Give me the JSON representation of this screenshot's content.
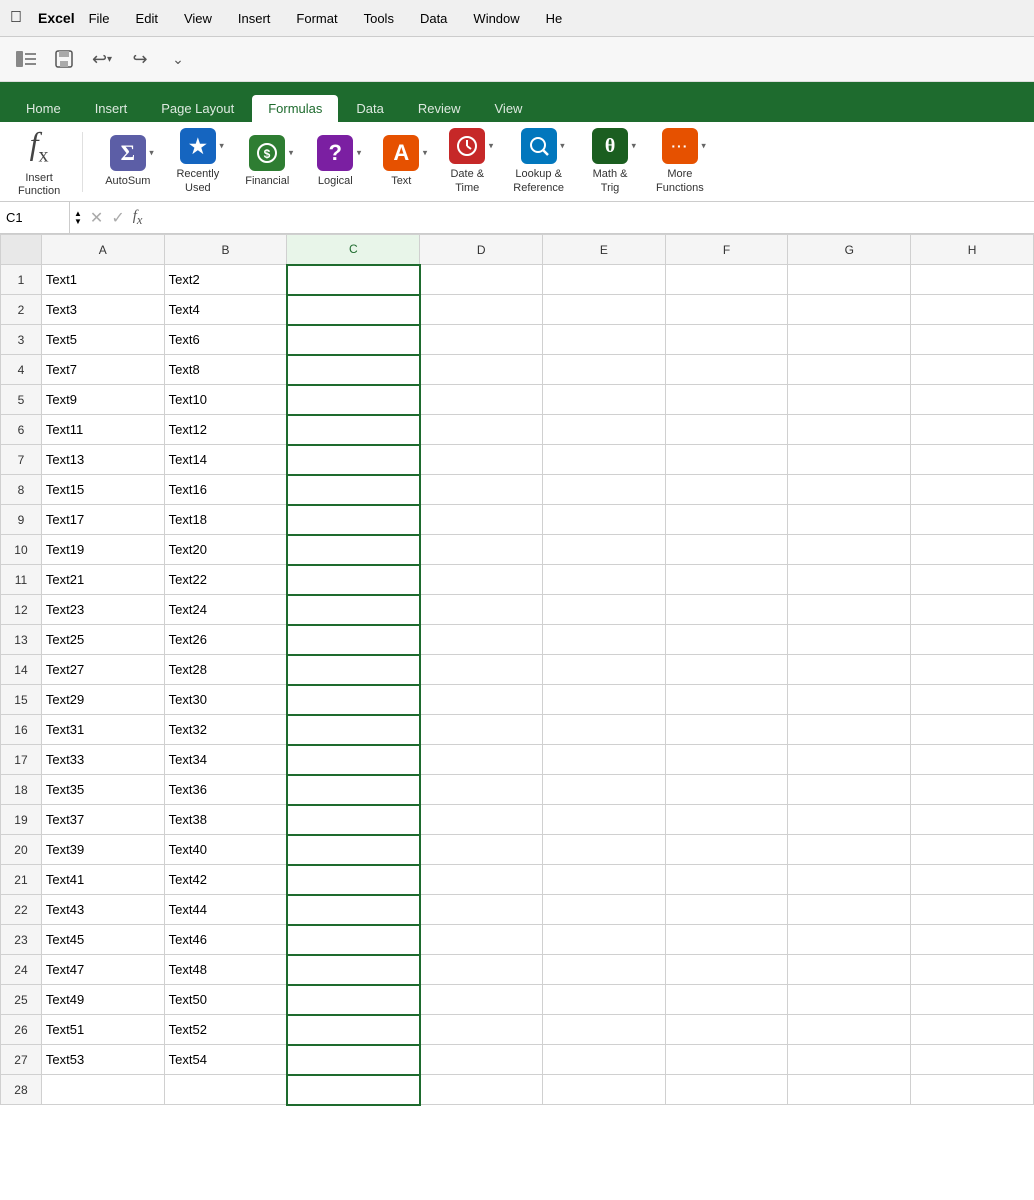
{
  "menubar": {
    "app": "Excel",
    "items": [
      "File",
      "Edit",
      "View",
      "Insert",
      "Format",
      "Tools",
      "Data",
      "Window",
      "He"
    ]
  },
  "toolbar": {
    "buttons": [
      "sidebar-icon",
      "save-icon",
      "undo-icon",
      "redo-icon",
      "more-icon"
    ]
  },
  "ribbonTabs": {
    "tabs": [
      "Home",
      "Insert",
      "Page Layout",
      "Formulas",
      "Data",
      "Review",
      "View"
    ],
    "activeTab": "Formulas"
  },
  "ribbonGroups": [
    {
      "id": "insert-function",
      "icon": "fx",
      "label": "Insert\nFunction",
      "color": "#888",
      "type": "fx"
    },
    {
      "id": "autosum",
      "icon": "Σ",
      "label": "AutoSum",
      "color": "#5b5ea6",
      "hasArrow": true
    },
    {
      "id": "recently-used",
      "icon": "★",
      "label": "Recently\nUsed",
      "color": "#1565c0",
      "hasArrow": true
    },
    {
      "id": "financial",
      "icon": "$",
      "label": "Financial",
      "color": "#2e7d32",
      "hasArrow": true
    },
    {
      "id": "logical",
      "icon": "?",
      "label": "Logical",
      "color": "#7b1fa2",
      "hasArrow": true
    },
    {
      "id": "text",
      "icon": "A",
      "label": "Text",
      "color": "#e65100",
      "hasArrow": true
    },
    {
      "id": "date-time",
      "icon": "⏰",
      "label": "Date &\nTime",
      "color": "#c62828",
      "hasArrow": true
    },
    {
      "id": "lookup-reference",
      "icon": "🔍",
      "label": "Lookup &\nReference",
      "color": "#0277bd",
      "hasArrow": true
    },
    {
      "id": "math-trig",
      "icon": "θ",
      "label": "Math &\nTrig",
      "color": "#1b5e20",
      "hasArrow": true
    },
    {
      "id": "more-functions",
      "icon": "···",
      "label": "More\nFunctions",
      "color": "#e65100",
      "hasArrow": true
    }
  ],
  "formulaBar": {
    "cellRef": "C1",
    "formula": ""
  },
  "columns": [
    "",
    "A",
    "B",
    "C",
    "D",
    "E",
    "F",
    "G",
    "H"
  ],
  "rows": [
    {
      "row": 1,
      "A": "Text1",
      "B": "Text2",
      "C": "",
      "D": "",
      "E": "",
      "F": "",
      "G": "",
      "H": ""
    },
    {
      "row": 2,
      "A": "Text3",
      "B": "Text4",
      "C": "",
      "D": "",
      "E": "",
      "F": "",
      "G": "",
      "H": ""
    },
    {
      "row": 3,
      "A": "Text5",
      "B": "Text6",
      "C": "",
      "D": "",
      "E": "",
      "F": "",
      "G": "",
      "H": ""
    },
    {
      "row": 4,
      "A": "Text7",
      "B": "Text8",
      "C": "",
      "D": "",
      "E": "",
      "F": "",
      "G": "",
      "H": ""
    },
    {
      "row": 5,
      "A": "Text9",
      "B": "Text10",
      "C": "",
      "D": "",
      "E": "",
      "F": "",
      "G": "",
      "H": ""
    },
    {
      "row": 6,
      "A": "Text11",
      "B": "Text12",
      "C": "",
      "D": "",
      "E": "",
      "F": "",
      "G": "",
      "H": ""
    },
    {
      "row": 7,
      "A": "Text13",
      "B": "Text14",
      "C": "",
      "D": "",
      "E": "",
      "F": "",
      "G": "",
      "H": ""
    },
    {
      "row": 8,
      "A": "Text15",
      "B": "Text16",
      "C": "",
      "D": "",
      "E": "",
      "F": "",
      "G": "",
      "H": ""
    },
    {
      "row": 9,
      "A": "Text17",
      "B": "Text18",
      "C": "",
      "D": "",
      "E": "",
      "F": "",
      "G": "",
      "H": ""
    },
    {
      "row": 10,
      "A": "Text19",
      "B": "Text20",
      "C": "",
      "D": "",
      "E": "",
      "F": "",
      "G": "",
      "H": ""
    },
    {
      "row": 11,
      "A": "Text21",
      "B": "Text22",
      "C": "",
      "D": "",
      "E": "",
      "F": "",
      "G": "",
      "H": ""
    },
    {
      "row": 12,
      "A": "Text23",
      "B": "Text24",
      "C": "",
      "D": "",
      "E": "",
      "F": "",
      "G": "",
      "H": ""
    },
    {
      "row": 13,
      "A": "Text25",
      "B": "Text26",
      "C": "",
      "D": "",
      "E": "",
      "F": "",
      "G": "",
      "H": ""
    },
    {
      "row": 14,
      "A": "Text27",
      "B": "Text28",
      "C": "",
      "D": "",
      "E": "",
      "F": "",
      "G": "",
      "H": ""
    },
    {
      "row": 15,
      "A": "Text29",
      "B": "Text30",
      "C": "",
      "D": "",
      "E": "",
      "F": "",
      "G": "",
      "H": ""
    },
    {
      "row": 16,
      "A": "Text31",
      "B": "Text32",
      "C": "",
      "D": "",
      "E": "",
      "F": "",
      "G": "",
      "H": ""
    },
    {
      "row": 17,
      "A": "Text33",
      "B": "Text34",
      "C": "",
      "D": "",
      "E": "",
      "F": "",
      "G": "",
      "H": ""
    },
    {
      "row": 18,
      "A": "Text35",
      "B": "Text36",
      "C": "",
      "D": "",
      "E": "",
      "F": "",
      "G": "",
      "H": ""
    },
    {
      "row": 19,
      "A": "Text37",
      "B": "Text38",
      "C": "",
      "D": "",
      "E": "",
      "F": "",
      "G": "",
      "H": ""
    },
    {
      "row": 20,
      "A": "Text39",
      "B": "Text40",
      "C": "",
      "D": "",
      "E": "",
      "F": "",
      "G": "",
      "H": ""
    },
    {
      "row": 21,
      "A": "Text41",
      "B": "Text42",
      "C": "",
      "D": "",
      "E": "",
      "F": "",
      "G": "",
      "H": ""
    },
    {
      "row": 22,
      "A": "Text43",
      "B": "Text44",
      "C": "",
      "D": "",
      "E": "",
      "F": "",
      "G": "",
      "H": ""
    },
    {
      "row": 23,
      "A": "Text45",
      "B": "Text46",
      "C": "",
      "D": "",
      "E": "",
      "F": "",
      "G": "",
      "H": ""
    },
    {
      "row": 24,
      "A": "Text47",
      "B": "Text48",
      "C": "",
      "D": "",
      "E": "",
      "F": "",
      "G": "",
      "H": ""
    },
    {
      "row": 25,
      "A": "Text49",
      "B": "Text50",
      "C": "",
      "D": "",
      "E": "",
      "F": "",
      "G": "",
      "H": ""
    },
    {
      "row": 26,
      "A": "Text51",
      "B": "Text52",
      "C": "",
      "D": "",
      "E": "",
      "F": "",
      "G": "",
      "H": ""
    },
    {
      "row": 27,
      "A": "Text53",
      "B": "Text54",
      "C": "",
      "D": "",
      "E": "",
      "F": "",
      "G": "",
      "H": ""
    },
    {
      "row": 28,
      "A": "",
      "B": "",
      "C": "",
      "D": "",
      "E": "",
      "F": "",
      "G": "",
      "H": ""
    }
  ]
}
